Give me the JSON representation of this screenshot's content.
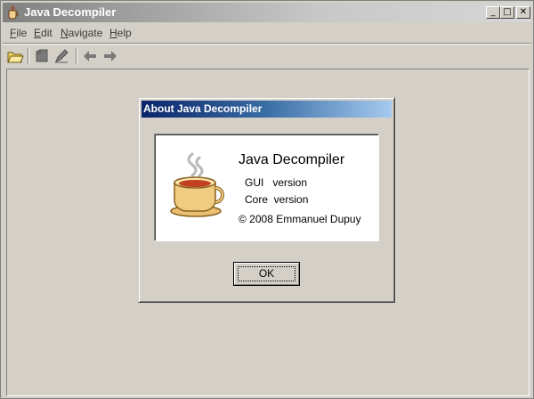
{
  "window": {
    "title": "Java Decompiler",
    "controls": {
      "minimize": "_",
      "maximize": "□",
      "close": "✕"
    }
  },
  "menu": {
    "items": [
      {
        "label": "File"
      },
      {
        "label": "Edit"
      },
      {
        "label": "Navigate"
      },
      {
        "label": "Help"
      }
    ]
  },
  "toolbar": {
    "buttons": [
      "open-folder-icon",
      "open-type-icon",
      "edit-icon",
      "back-icon",
      "forward-icon"
    ]
  },
  "about_dialog": {
    "title": "About Java Decompiler",
    "app_name": "Java Decompiler",
    "gui_version": "GUI   version",
    "core_version": "Core  version",
    "copyright": "© 2008 Emmanuel Dupuy",
    "ok_label": "OK"
  },
  "colors": {
    "dialog_title_start": "#0a246a",
    "dialog_title_end": "#a6caf0",
    "face": "#d4d0c8"
  }
}
